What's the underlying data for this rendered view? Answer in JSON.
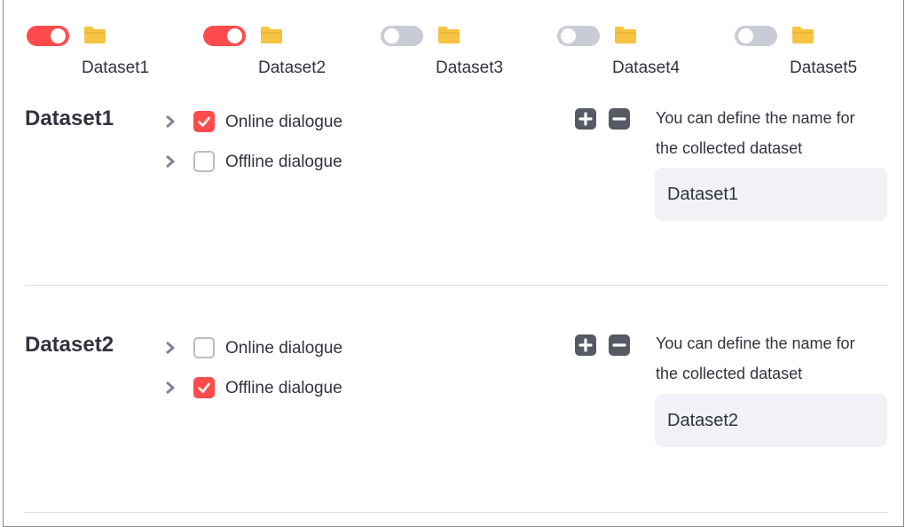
{
  "toggles": [
    {
      "label": "Dataset1",
      "on": true
    },
    {
      "label": "Dataset2",
      "on": true
    },
    {
      "label": "Dataset3",
      "on": false
    },
    {
      "label": "Dataset4",
      "on": false
    },
    {
      "label": "Dataset5",
      "on": false
    }
  ],
  "sections": [
    {
      "title": "Dataset1",
      "options": [
        {
          "label": "Online dialogue",
          "checked": true
        },
        {
          "label": "Offline dialogue",
          "checked": false
        }
      ],
      "help_line1": "You can define the name for",
      "help_line2": "the collected dataset",
      "name_value": "Dataset1"
    },
    {
      "title": "Dataset2",
      "options": [
        {
          "label": "Online dialogue",
          "checked": false
        },
        {
          "label": "Offline dialogue",
          "checked": true
        }
      ],
      "help_line1": "You can define the name for",
      "help_line2": "the collected dataset",
      "name_value": "Dataset2"
    }
  ],
  "colors": {
    "accent": "#ff4b4b",
    "toggle_off": "#c9ccd5",
    "folder": "#f6c342",
    "icon_button": "#555a63",
    "input_bg": "#f0f2f6"
  },
  "icons": {
    "folder": "folder-icon",
    "expand": "chevron-right-icon",
    "add": "plus-square-icon",
    "remove": "minus-square-icon",
    "check": "check-icon"
  }
}
